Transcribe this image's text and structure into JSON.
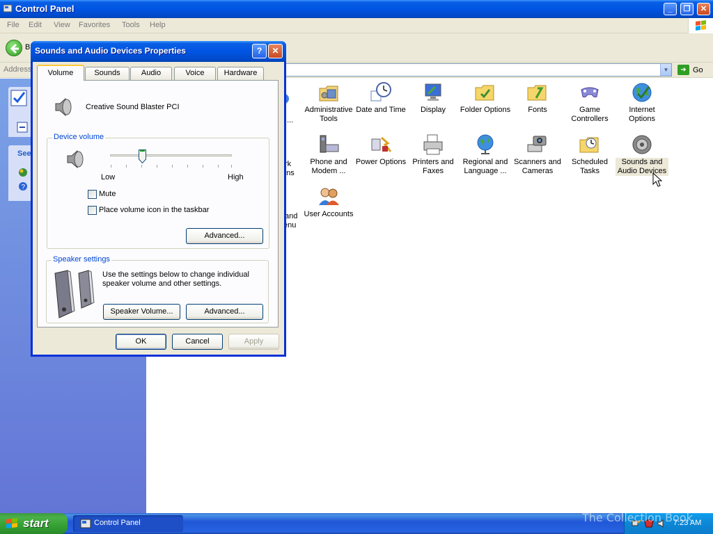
{
  "window": {
    "title": "Control Panel",
    "menu": [
      "File",
      "Edit",
      "View",
      "Favorites",
      "Tools",
      "Help"
    ],
    "back_label": "B",
    "address_label": "Address",
    "go_label": "Go",
    "sidebar_see_label": "See"
  },
  "control_panel_items": [
    {
      "label": "Administrative Tools",
      "icon": "admin-tools-icon"
    },
    {
      "label": "Date and Time",
      "icon": "clock-icon"
    },
    {
      "label": "Display",
      "icon": "display-icon"
    },
    {
      "label": "Folder Options",
      "icon": "folder-icon"
    },
    {
      "label": "Fonts",
      "icon": "fonts-folder-icon"
    },
    {
      "label": "Game Controllers",
      "icon": "gamepad-icon"
    },
    {
      "label": "Internet Options",
      "icon": "globe-icon"
    },
    {
      "label": "Phone and Modem ...",
      "icon": "phone-icon"
    },
    {
      "label": "Power Options",
      "icon": "power-icon"
    },
    {
      "label": "Printers and Faxes",
      "icon": "printer-icon"
    },
    {
      "label": "Regional and Language ...",
      "icon": "globe-stand-icon"
    },
    {
      "label": "Scanners and Cameras",
      "icon": "scanner-icon"
    },
    {
      "label": "Scheduled Tasks",
      "icon": "tasks-folder-icon"
    },
    {
      "label": "Sounds and Audio Devices",
      "icon": "speaker-icon",
      "selected": true
    },
    {
      "label": "User Accounts",
      "icon": "users-icon"
    }
  ],
  "partial_items": [
    "...",
    "rk",
    "ons",
    "and",
    "enu"
  ],
  "dialog": {
    "title": "Sounds and Audio Devices Properties",
    "help_glyph": "?",
    "close_glyph": "✕",
    "tabs": [
      "Volume",
      "Sounds",
      "Audio",
      "Voice",
      "Hardware"
    ],
    "active_tab": "Volume",
    "device_name": "Creative Sound Blaster PCI",
    "device_volume_label": "Device volume",
    "slider_low": "Low",
    "slider_high": "High",
    "volume_level": 0.26,
    "mute_label": "Mute",
    "mute_checked": false,
    "taskbar_icon_label": "Place volume icon in the taskbar",
    "taskbar_icon_checked": false,
    "advanced_label": "Advanced...",
    "speaker_settings_label": "Speaker settings",
    "speaker_text": "Use the settings below to change individual speaker volume and other settings.",
    "speaker_volume_label": "Speaker Volume...",
    "speaker_advanced_label": "Advanced...",
    "ok_label": "OK",
    "cancel_label": "Cancel",
    "apply_label": "Apply"
  },
  "taskbar": {
    "start_label": "start",
    "task_label": "Control Panel",
    "clock": "7:23 AM",
    "watermark": "The Collection Book"
  }
}
